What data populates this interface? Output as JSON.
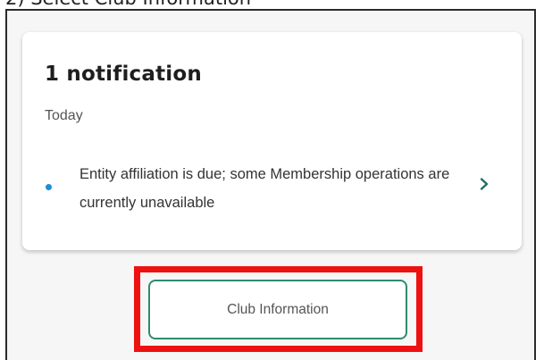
{
  "caption": "2) Select Club Information",
  "card": {
    "title": "1 notification",
    "section_label": "Today",
    "notification": {
      "text": "Entity affiliation is due; some Membership operations are currently unavailable",
      "dot_color": "#1a8fd8"
    }
  },
  "club_button": {
    "label": "Club Information",
    "border_color": "#2f8a6f"
  },
  "highlight": {
    "color": "#ee1111"
  }
}
